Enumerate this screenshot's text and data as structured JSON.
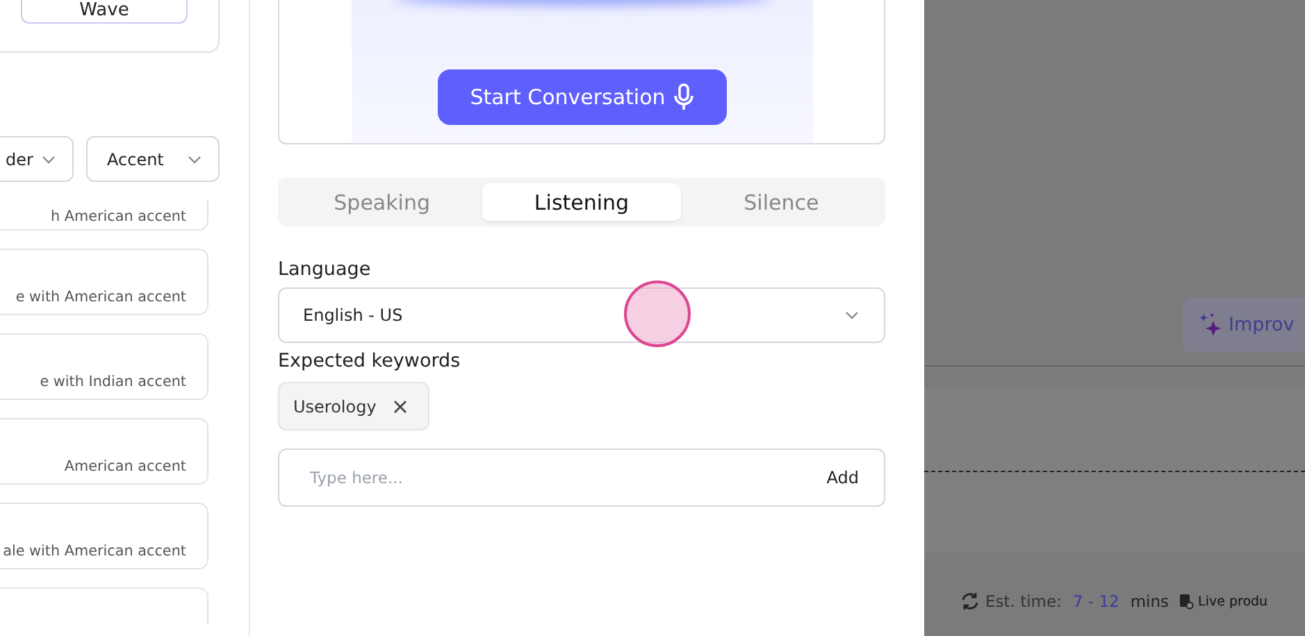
{
  "left_panel": {
    "style_button": "Wave",
    "filters": [
      {
        "label": "der"
      },
      {
        "label": "Accent"
      }
    ],
    "voices": [
      {
        "kind": "described",
        "description": "h American accent"
      },
      {
        "kind": "described",
        "description": "e with American accent"
      },
      {
        "kind": "described",
        "description": "e with Indian accent"
      },
      {
        "kind": "described",
        "description": "American accent"
      },
      {
        "kind": "described",
        "description": "ale with American accent"
      },
      {
        "kind": "clipped"
      }
    ]
  },
  "preview": {
    "start_button": "Start Conversation"
  },
  "tabs": [
    {
      "label": "Speaking",
      "selected": false
    },
    {
      "label": "Listening",
      "selected": true
    },
    {
      "label": "Silence",
      "selected": false
    }
  ],
  "language": {
    "label": "Language",
    "value": "English - US"
  },
  "keywords": {
    "label": "Expected keywords",
    "chips": [
      {
        "label": "Userology"
      }
    ],
    "input": {
      "placeholder": "Type here...",
      "add_button": "Add"
    }
  },
  "background": {
    "improve_button": "Improv",
    "est_label": "Est. time:",
    "est_value": "7 - 12",
    "est_unit": "mins",
    "live_label": "Live produ"
  }
}
